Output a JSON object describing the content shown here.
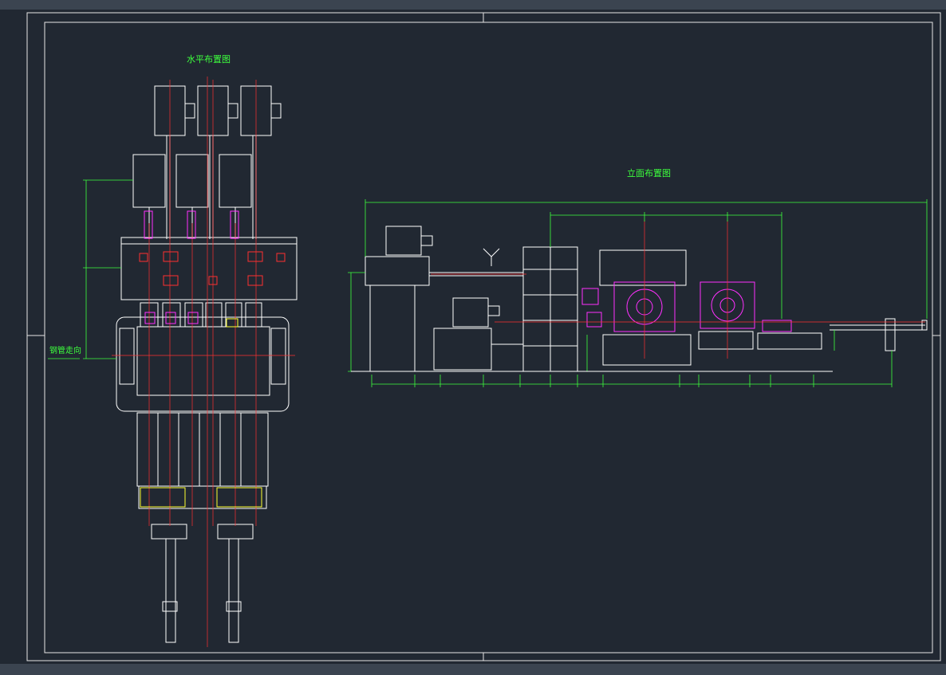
{
  "titles": {
    "plan_view": "水平布置图",
    "elevation_view": "立面布置图",
    "pipe_direction": "钢管走向"
  },
  "colors": {
    "background": "#212832",
    "frame": "#e6e6e6",
    "outline": "#ffffff",
    "centerline": "#ff3030",
    "dimension": "#3dff3d",
    "gearbox": "#ff30ff",
    "highlight": "#ffff30",
    "chrome_bar": "#3b4450"
  },
  "stand_count": 6,
  "motor_count_plan": 6
}
